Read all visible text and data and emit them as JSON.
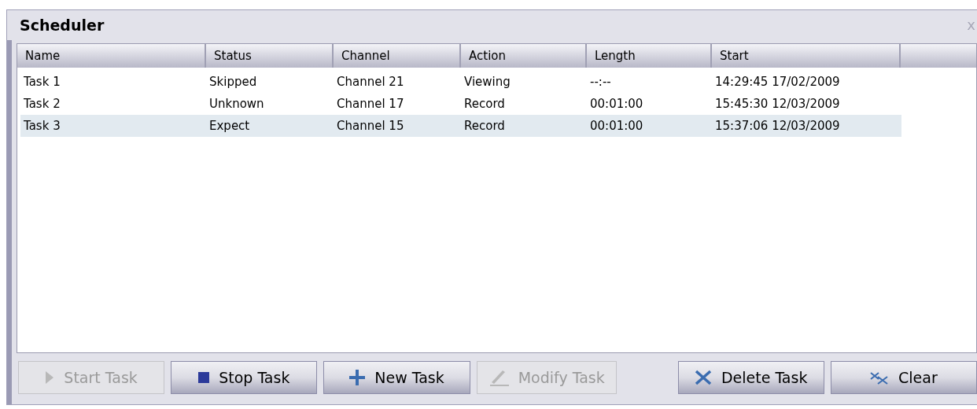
{
  "window": {
    "title": "Scheduler",
    "close": "x"
  },
  "table": {
    "columns": [
      "Name",
      "Status",
      "Channel",
      "Action",
      "Length",
      "Start"
    ],
    "rows": [
      {
        "cells": [
          "Task 1",
          "Skipped",
          "Channel 21",
          "Viewing",
          "--:--",
          "14:29:45 17/02/2009"
        ],
        "selected": false
      },
      {
        "cells": [
          "Task 2",
          "Unknown",
          "Channel 17",
          "Record",
          "00:01:00",
          "15:45:30 12/03/2009"
        ],
        "selected": false
      },
      {
        "cells": [
          "Task 3",
          "Expect",
          "Channel 15",
          "Record",
          "00:01:00",
          "15:37:06 12/03/2009"
        ],
        "selected": true
      }
    ]
  },
  "buttons": [
    {
      "label": "Start Task",
      "kind": "play",
      "disabled": true
    },
    {
      "label": "Stop Task",
      "kind": "stop",
      "disabled": false
    },
    {
      "label": "New Task",
      "kind": "plus",
      "disabled": false
    },
    {
      "label": "Modify Task",
      "kind": "pen",
      "disabled": true
    },
    {
      "label": "Delete Task",
      "kind": "delete",
      "disabled": false
    },
    {
      "label": "Clear",
      "kind": "clear",
      "disabled": false
    }
  ]
}
